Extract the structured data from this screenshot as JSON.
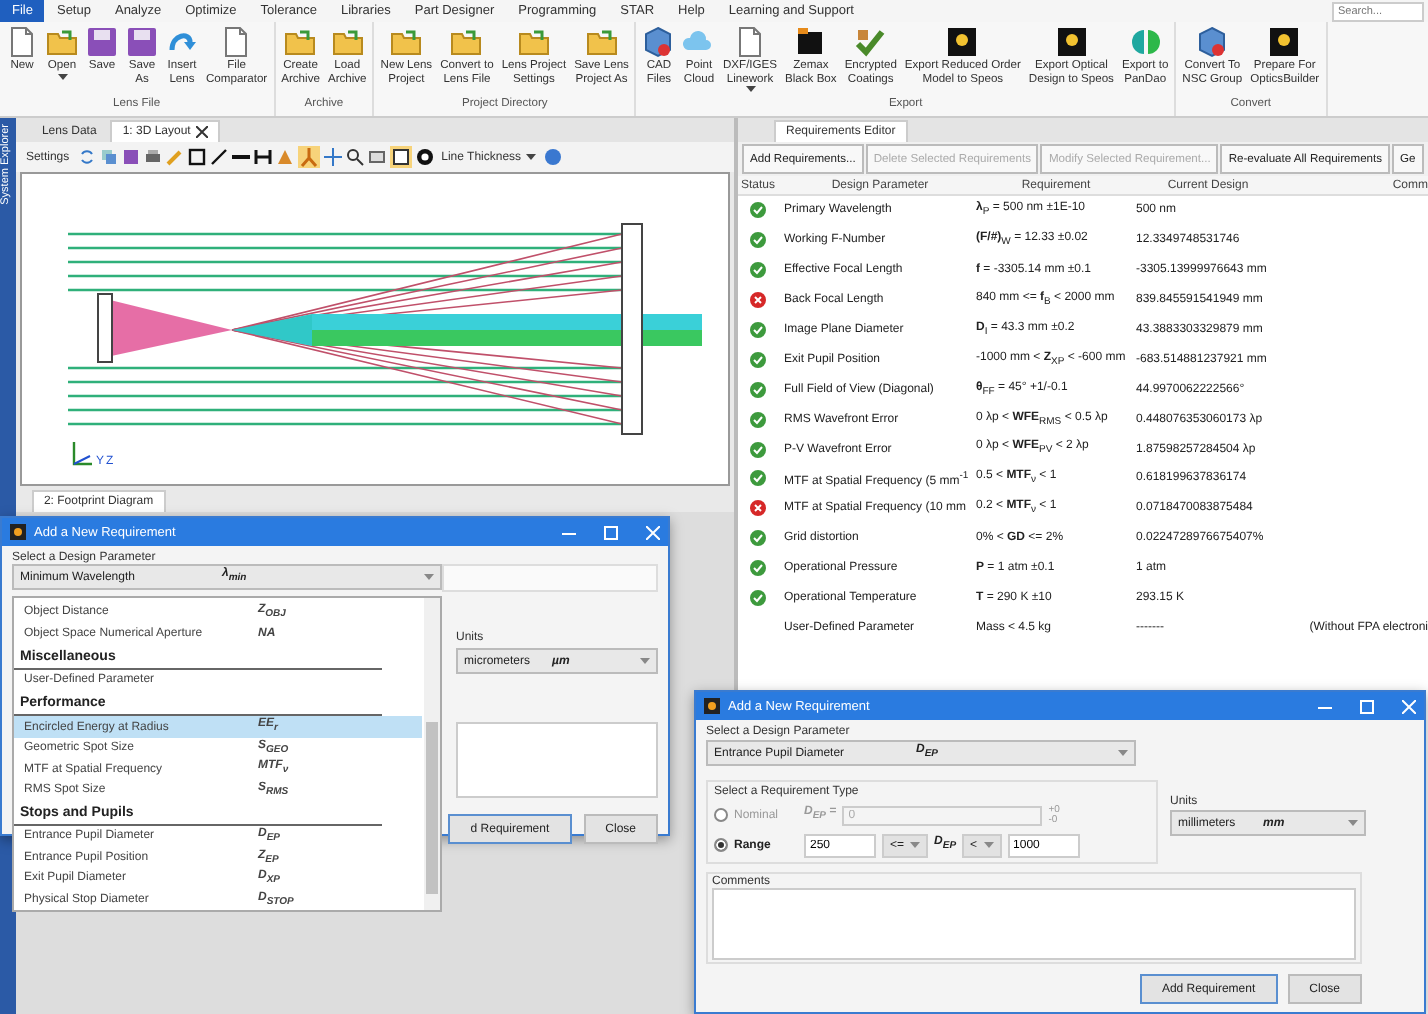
{
  "menu": [
    {
      "label": "File",
      "selected": true
    },
    {
      "label": "Setup",
      "selected": false
    },
    {
      "label": "Analyze",
      "selected": false
    },
    {
      "label": "Optimize",
      "selected": false
    },
    {
      "label": "Tolerance",
      "selected": false
    },
    {
      "label": "Libraries",
      "selected": false
    },
    {
      "label": "Part Designer",
      "selected": false
    },
    {
      "label": "Programming",
      "selected": false
    },
    {
      "label": "STAR",
      "selected": false
    },
    {
      "label": "Help",
      "selected": false
    },
    {
      "label": "Learning and Support",
      "selected": false
    }
  ],
  "search": {
    "placeholder": "Search..."
  },
  "ribbon": [
    {
      "caption": "Lens File",
      "buttons": [
        {
          "label": "New",
          "dropdown": false
        },
        {
          "label": "Open",
          "dropdown": true
        },
        {
          "label": "Save",
          "dropdown": false
        },
        {
          "label": "Save\nAs",
          "dropdown": false
        },
        {
          "label": "Insert\nLens",
          "dropdown": false
        },
        {
          "label": "File\nComparator",
          "dropdown": false
        }
      ]
    },
    {
      "caption": "Archive",
      "buttons": [
        {
          "label": "Create\nArchive",
          "dropdown": false
        },
        {
          "label": "Load\nArchive",
          "dropdown": false
        }
      ]
    },
    {
      "caption": "Project Directory",
      "buttons": [
        {
          "label": "New Lens\nProject",
          "dropdown": false
        },
        {
          "label": "Convert to\nLens File",
          "dropdown": false
        },
        {
          "label": "Lens Project\nSettings",
          "dropdown": false
        },
        {
          "label": "Save Lens\nProject As",
          "dropdown": false
        }
      ]
    },
    {
      "caption": "Export",
      "buttons": [
        {
          "label": "CAD\nFiles",
          "dropdown": false
        },
        {
          "label": "Point\nCloud",
          "dropdown": false
        },
        {
          "label": "DXF/IGES\nLinework",
          "dropdown": true
        },
        {
          "label": "Zemax\nBlack Box",
          "dropdown": false
        },
        {
          "label": "Encrypted\nCoatings",
          "dropdown": false
        },
        {
          "label": "Export Reduced Order\nModel to Speos",
          "dropdown": false
        },
        {
          "label": "Export Optical\nDesign to Speos",
          "dropdown": false
        },
        {
          "label": "Export to\nPanDao",
          "dropdown": false
        }
      ]
    },
    {
      "caption": "Convert",
      "buttons": [
        {
          "label": "Convert To\nNSC Group",
          "dropdown": false
        },
        {
          "label": "Prepare For\nOpticsBuilder",
          "dropdown": false
        }
      ]
    }
  ],
  "side_strip": {
    "label": "System Explorer"
  },
  "left_tabs": [
    {
      "label": "Lens Data",
      "selected": false,
      "closable": false
    },
    {
      "label": "1: 3D Layout",
      "selected": true,
      "closable": true
    }
  ],
  "layout_toolbar": {
    "settings": "Settings",
    "line_thickness": "Line Thickness"
  },
  "axes": {
    "y": "Y",
    "z": "Z"
  },
  "footprint_tab": {
    "label": "2: Footprint Diagram"
  },
  "editor": {
    "tab": "Requirements Editor",
    "buttons": [
      {
        "label": "Add Requirements...",
        "disabled": false
      },
      {
        "label": "Delete Selected Requirements",
        "disabled": true
      },
      {
        "label": "Modify Selected Requirement...",
        "disabled": true
      },
      {
        "label": "Re-evaluate All Requirements",
        "disabled": false
      },
      {
        "label": "Ge",
        "disabled": false
      }
    ],
    "columns": [
      "Status",
      "Design Parameter",
      "Requirement",
      "Current Design",
      "Comm"
    ],
    "rows": [
      {
        "passed": true,
        "parameter": "Primary Wavelength",
        "requirement": "**λ**$_{P}$ = 500 nm ±1E-10",
        "current": "500 nm"
      },
      {
        "passed": true,
        "parameter": "Working F-Number",
        "requirement": "**(F/#)**$_{W}$ = 12.33 ±0.02",
        "current": "12.3349748531746"
      },
      {
        "passed": true,
        "parameter": "Effective Focal Length",
        "requirement": "**f** = -3305.14 mm ±0.1",
        "current": "-3305.13999976643 mm"
      },
      {
        "passed": false,
        "parameter": "Back Focal Length",
        "requirement": "840 mm <= **f**$_{B}$ < 2000 mm",
        "current": "839.845591541949 mm"
      },
      {
        "passed": true,
        "parameter": "Image Plane Diameter",
        "requirement": "**D**$_{I}$ = 43.3 mm ±0.2",
        "current": "43.3883303329879 mm"
      },
      {
        "passed": true,
        "parameter": "Exit Pupil Position",
        "requirement": "-1000 mm < **Z**$_{XP}$ < -600 mm",
        "current": "-683.514881237921 mm"
      },
      {
        "passed": true,
        "parameter": "Full Field of View (Diagonal)",
        "requirement": "**θ**$_{FF}$ = 45° +1/-0.1",
        "current": "44.9970062222566°"
      },
      {
        "passed": true,
        "parameter": "RMS Wavefront Error",
        "requirement": "0 λp < **WFE**$_{RMS}$ < 0.5 λp",
        "current": "0.448076353060173 λp"
      },
      {
        "passed": true,
        "parameter": "P-V Wavefront Error",
        "requirement": "0 λp < **WFE**$_{PV}$ < 2 λp",
        "current": "1.87598257284504 λp"
      },
      {
        "passed": true,
        "parameter": "MTF at Spatial Frequency (5 mm$^{-1}$",
        "requirement": "0.5 < **MTF**$_{ν}$ < 1",
        "current": "0.618199637836174"
      },
      {
        "passed": false,
        "parameter": "MTF at Spatial Frequency (10 mm",
        "requirement": "0.2 < **MTF**$_{ν}$ < 1",
        "current": "0.0718470083875484"
      },
      {
        "passed": true,
        "parameter": "Grid distortion",
        "requirement": "0% < **GD** <= 2%",
        "current": "0.0224728976675407%"
      },
      {
        "passed": true,
        "parameter": "Operational Pressure",
        "requirement": "**P** = 1 atm ±0.1",
        "current": "1 atm"
      },
      {
        "passed": true,
        "parameter": "Operational Temperature",
        "requirement": "**T** = 290 K ±10",
        "current": "293.15 K"
      },
      {
        "parameter": "User-Defined Parameter",
        "requirement": "Mass < 4.5 kg",
        "current": "-------",
        "comment": "(Without FPA electroni"
      }
    ]
  },
  "dialog_back": {
    "title": "Add a New Requirement",
    "param_label": "Select a Design Parameter",
    "combo": {
      "name": "Minimum Wavelength",
      "symbol": "λ$_{min}$"
    },
    "list": [
      {
        "kind": "item",
        "name": "Object Distance",
        "symbol": "Z$_{OBJ}$",
        "selected": false
      },
      {
        "kind": "item",
        "name": "Object Space Numerical Aperture",
        "symbol": "NA",
        "selected": false
      },
      {
        "kind": "header",
        "name": "Miscellaneous"
      },
      {
        "kind": "item",
        "name": "User-Defined Parameter",
        "selected": false
      },
      {
        "kind": "header",
        "name": "Performance"
      },
      {
        "kind": "item",
        "name": "Encircled Energy at Radius",
        "symbol": "EE$_{r}$",
        "selected": true
      },
      {
        "kind": "item",
        "name": "Geometric Spot Size",
        "symbol": "S$_{GEO}$",
        "selected": false
      },
      {
        "kind": "item",
        "name": "MTF at Spatial Frequency",
        "symbol": "MTF$_{ν}$",
        "selected": false
      },
      {
        "kind": "item",
        "name": "RMS Spot Size",
        "symbol": "S$_{RMS}$",
        "selected": false
      },
      {
        "kind": "header",
        "name": "Stops and Pupils"
      },
      {
        "kind": "item",
        "name": "Entrance Pupil Diameter",
        "symbol": "D$_{EP}$",
        "selected": false
      },
      {
        "kind": "item",
        "name": "Entrance Pupil Position",
        "symbol": "Z$_{EP}$",
        "selected": false
      },
      {
        "kind": "item",
        "name": "Exit Pupil Diameter",
        "symbol": "D$_{XP}$",
        "selected": false
      },
      {
        "kind": "item",
        "name": "Physical Stop Diameter",
        "symbol": "D$_{STOP}$",
        "selected": false
      }
    ],
    "units_label": "Units",
    "units": {
      "name": "micrometers",
      "symbol": "µm"
    },
    "buttons": [
      "d Requirement",
      "Close"
    ]
  },
  "dialog_front": {
    "title": "Add a New Requirement",
    "param_label": "Select a Design Parameter",
    "combo": {
      "name": "Entrance Pupil Diameter",
      "symbol": "D$_{EP}$"
    },
    "type_label": "Select a Requirement Type",
    "nominal": {
      "label": "Nominal",
      "selected": false,
      "symbol": "D$_{EP}$ =",
      "value": "0",
      "plus": "+0",
      "minus": "-0"
    },
    "range": {
      "label": "Range",
      "selected": true,
      "low": "250",
      "op1": "<=",
      "symbol": "D$_{EP}$",
      "op2": "<",
      "high": "1000"
    },
    "units_label": "Units",
    "units": {
      "name": "millimeters",
      "symbol": "mm"
    },
    "comments_label": "Comments",
    "buttons": [
      "Add Requirement",
      "Close"
    ]
  }
}
